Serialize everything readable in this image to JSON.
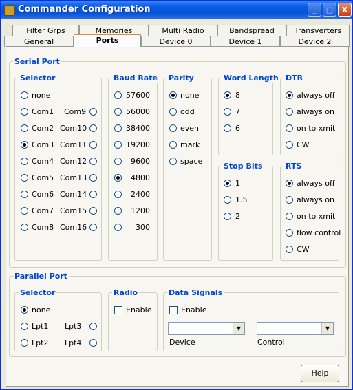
{
  "window": {
    "title": "Commander Configuration",
    "min": "_",
    "max": "□",
    "close": "X"
  },
  "tabs_row1": [
    "Filter Grps",
    "Memories",
    "Multi Radio",
    "Bandspread",
    "Transverters"
  ],
  "tabs_row2": [
    "General",
    "Ports",
    "Device 0",
    "Device 1",
    "Device 2"
  ],
  "serial": {
    "title": "Serial Port",
    "selector": {
      "title": "Selector",
      "none": "none",
      "left": [
        "Com1",
        "Com2",
        "Com3",
        "Com4",
        "Com5",
        "Com6",
        "Com7",
        "Com8"
      ],
      "right": [
        "Com9",
        "Com10",
        "Com11",
        "Com12",
        "Com13",
        "Com14",
        "Com15",
        "Com16"
      ],
      "selected": "Com3"
    },
    "baud": {
      "title": "Baud Rate",
      "items": [
        "57600",
        "56000",
        "38400",
        "19200",
        "9600",
        "4800",
        "2400",
        "1200",
        "300"
      ],
      "selected": "4800"
    },
    "parity": {
      "title": "Parity",
      "items": [
        "none",
        "odd",
        "even",
        "mark",
        "space"
      ],
      "selected": "none"
    },
    "word_length": {
      "title": "Word Length",
      "items": [
        "8",
        "7",
        "6"
      ],
      "selected": "8"
    },
    "stop_bits": {
      "title": "Stop Bits",
      "items": [
        "1",
        "1.5",
        "2"
      ],
      "selected": "1"
    },
    "dtr": {
      "title": "DTR",
      "items": [
        "always off",
        "always on",
        "on to xmit",
        "CW"
      ],
      "selected": "always off"
    },
    "rts": {
      "title": "RTS",
      "items": [
        "always off",
        "always on",
        "on to xmit",
        "flow control",
        "CW"
      ],
      "selected": "always off"
    }
  },
  "parallel": {
    "title": "Parallel Port",
    "selector": {
      "title": "Selector",
      "none": "none",
      "left": [
        "Lpt1",
        "Lpt2"
      ],
      "right": [
        "Lpt3",
        "Lpt4"
      ],
      "selected": "none"
    },
    "radio": {
      "title": "Radio",
      "enable": "Enable"
    },
    "data_signals": {
      "title": "Data Signals",
      "enable": "Enable",
      "device_label": "Device",
      "control_label": "Control",
      "device_value": "",
      "control_value": ""
    }
  },
  "help_button": "Help",
  "colors": {
    "title_bar": "#0553d6",
    "legend": "#0046d5",
    "active_tab_accent": "#e68b2c"
  }
}
